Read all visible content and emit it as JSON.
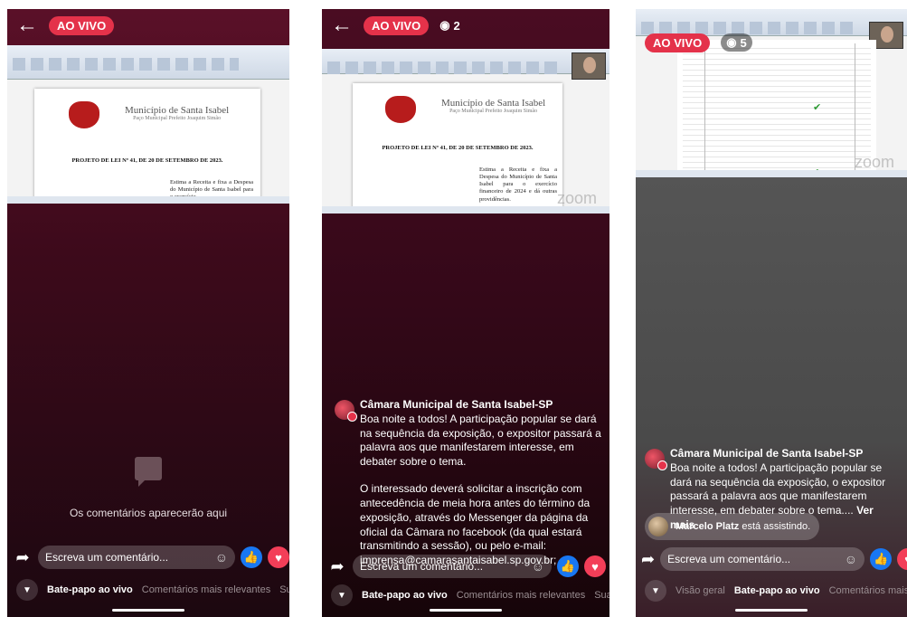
{
  "live_label": "AO VIVO",
  "colors": {
    "live_red": "#e4324a",
    "like_blue": "#1877f2",
    "love_red": "#f33e58"
  },
  "icons": {
    "back": "arrow-left-icon",
    "eye": "eye-icon",
    "share": "share-arrow-icon",
    "sticker": "sticker-icon",
    "like": "thumbs-up-icon",
    "love": "heart-icon",
    "chevron": "chevron-down-icon"
  },
  "document": {
    "municipality": "Município de Santa Isabel",
    "subtitle": "Paço Municipal Prefeito Joaquim Simão",
    "law_title": "PROJETO DE LEI Nº 41, DE 20 DE SETEMBRO DE 2023.",
    "ementa_p1": "Estima a Receita e fixa a Despesa do Município de Santa Isabel para o exercício",
    "ementa_p2": "Estima a Receita e fixa a Despesa do Município de Santa Isabel para o exercício financeiro de 2024 e dá outras providências."
  },
  "screens": [
    {
      "viewers": null,
      "empty_text": "Os comentários aparecerão aqui",
      "input_placeholder": "Escreva um comentário...",
      "tabs": [
        "Bate-papo ao vivo",
        "Comentários mais relevantes",
        "Suas re"
      ]
    },
    {
      "viewers": "2",
      "comment": {
        "author": "Câmara Municipal de Santa Isabel-SP",
        "paragraph1": "Boa noite a todos! A participação popular se dará na sequência da exposição, o expositor passará a palavra aos que manifestarem interesse, em debater sobre o tema.",
        "paragraph2": "O interessado deverá solicitar a inscrição com antecedência de meia hora antes do término da exposição, através do Messenger da página da oficial da Câmara no facebook (da qual estará transmitindo a sessão), ou pelo e-mail: imprensa@camarasantaisabel.sp.gov.br;"
      },
      "input_placeholder": "Escreva um comentário...",
      "tabs": [
        "Bate-papo ao vivo",
        "Comentários mais relevantes",
        "Suas re"
      ]
    },
    {
      "viewers": "5",
      "comment": {
        "author": "Câmara Municipal de Santa Isabel-SP",
        "text": "Boa noite a todos! A participação popular se dará na sequência da exposição, o expositor passará a palavra aos que manifestarem interesse, em debater sobre o tema....",
        "see_more": "Ver mais"
      },
      "joined": {
        "name": "Marcelo Platz",
        "action": "está assistindo."
      },
      "input_placeholder": "Escreva um comentário...",
      "tabs": [
        "Visão geral",
        "Bate-papo ao vivo",
        "Comentários mais releva"
      ]
    }
  ]
}
